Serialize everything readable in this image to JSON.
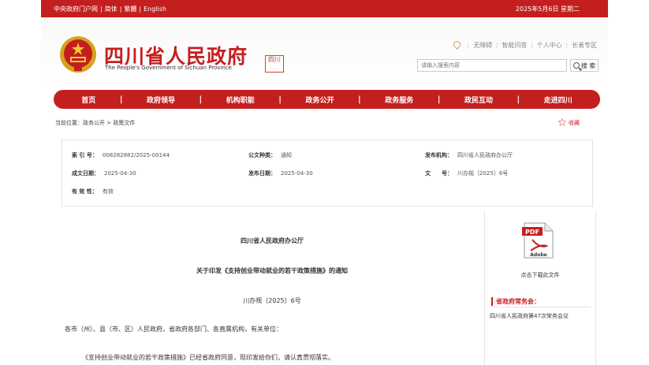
{
  "topbar": {
    "gov_portal": "中央政府门户网",
    "simplified": "简体",
    "traditional": "繁體",
    "english": "English",
    "date": "2025年5月6日 星期二"
  },
  "header": {
    "title": "四川省人民政府",
    "subtitle": "The People's Government of Sichuan Province",
    "seal_text": "四川"
  },
  "user_links": {
    "accessible": "无障碍",
    "smart_qa": "智能问答",
    "personal_center": "个人中心",
    "elder_zone": "长者专区"
  },
  "search": {
    "placeholder": "请输入搜索内容",
    "button_label": "搜 索"
  },
  "nav": {
    "items": [
      "首页",
      "政府领导",
      "机构职能",
      "政务公开",
      "政务服务",
      "政民互动",
      "走进四川"
    ]
  },
  "breadcrumb": "当前位置：政务公开 > 政策文件",
  "favorite_label": "收藏",
  "meta": {
    "index_label": "索 引 号：",
    "index_value": "008282882/2025-00144",
    "category_label": "公文种类：",
    "category_value": "通知",
    "issuer_label": "发布机构：",
    "issuer_value": "四川省人民政府办公厅",
    "written_label": "成文日期：",
    "written_value": "2025-04-30",
    "published_label": "发布日期：",
    "published_value": "2025-04-30",
    "docno_label": "文　　号：",
    "docno_value": "川办规〔2025〕6号",
    "validity_label": "有 效 性：",
    "validity_value": "有效"
  },
  "document": {
    "issuer": "四川省人民政府办公厅",
    "title": "关于印发《支持创业带动就业的若干政策措施》的通知",
    "number": "川办规〔2025〕6号",
    "addressee": "各市（州）、县（市、区）人民政府，省政府各部门、各直属机构，有关单位：",
    "body_first_line": "《支持创业带动就业的若干政策措施》已经省政府同意，现印发给你们，请认真贯彻落实。"
  },
  "sidebar": {
    "pdf_label": "PDF",
    "adobe_label": "Adobe",
    "download_label": "点击下载此文件",
    "section_heading": "省政府常务会：",
    "meeting_link": "四川省人民政府第47次常务会议"
  },
  "colors": {
    "brand_red": "#c41f1f",
    "accent_orange": "#d89a56"
  }
}
